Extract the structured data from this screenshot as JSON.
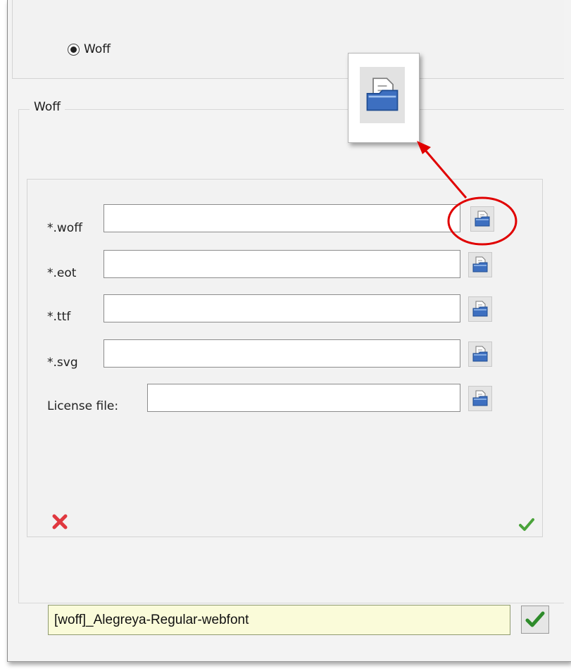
{
  "format_option": {
    "label": "Woff",
    "selected": true
  },
  "group": {
    "legend": "Woff"
  },
  "fields": {
    "woff": {
      "label": "*.woff",
      "value": ""
    },
    "eot": {
      "label": "*.eot",
      "value": ""
    },
    "ttf": {
      "label": "*.ttf",
      "value": ""
    },
    "svg": {
      "label": "*.svg",
      "value": ""
    },
    "license": {
      "label": "License file:",
      "value": ""
    }
  },
  "font_name": {
    "value": "[woff]_Alegreya-Regular-webfont"
  },
  "icons": {
    "browse": "folder-browse-icon",
    "cancel": "red-x-icon",
    "confirm": "green-check-icon"
  },
  "colors": {
    "annotation": "#e00000",
    "name_field_bg": "#fafbd9",
    "folder_blue": "#3d6fc0"
  }
}
